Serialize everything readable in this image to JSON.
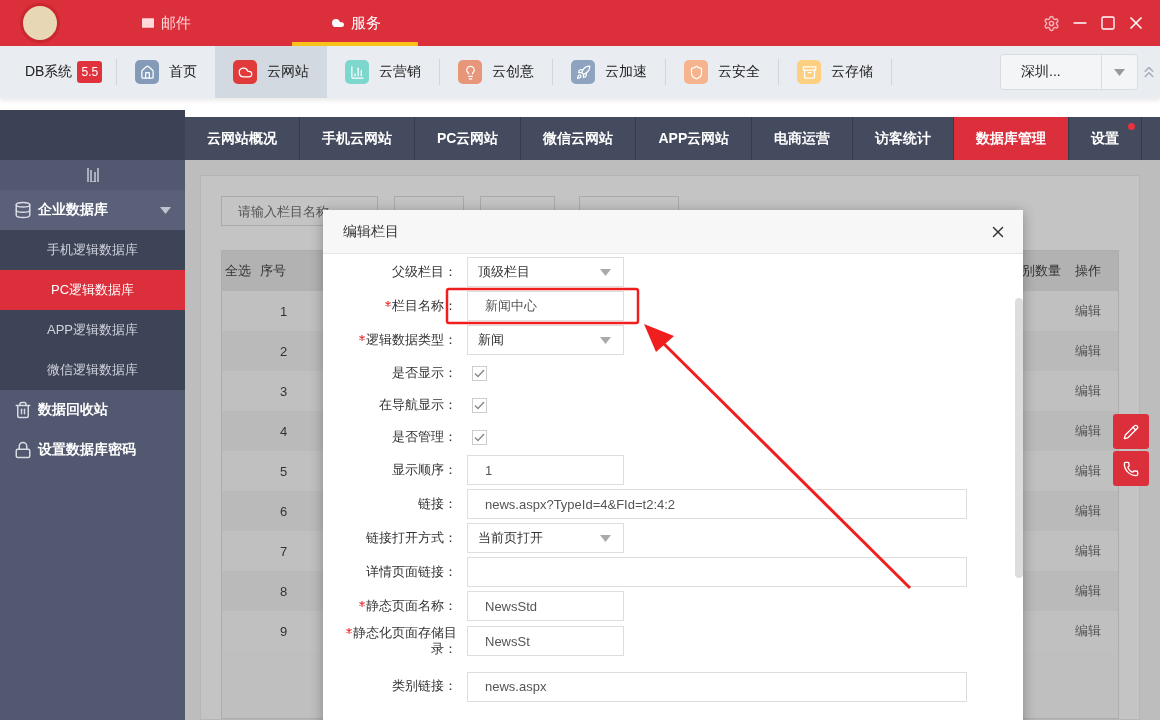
{
  "titlebar": {
    "tabs": [
      {
        "label": "邮件",
        "selected": false
      },
      {
        "label": "服务",
        "selected": true
      }
    ]
  },
  "toolbar": {
    "product": "DB系统",
    "version": "5.5",
    "items": [
      {
        "label": "首页",
        "color": "#849bb8",
        "selected": false
      },
      {
        "label": "云网站",
        "color": "#e03a3a",
        "selected": true
      },
      {
        "label": "云营销",
        "color": "#7dd7cc",
        "selected": false
      },
      {
        "label": "云创意",
        "color": "#e8967a",
        "selected": false
      },
      {
        "label": "云加速",
        "color": "#8da3bf",
        "selected": false
      },
      {
        "label": "云安全",
        "color": "#f5b38e",
        "selected": false
      },
      {
        "label": "云存储",
        "color": "#fdcf80",
        "selected": false
      }
    ],
    "region": "深圳..."
  },
  "sidebar": {
    "items": [
      {
        "label": "企业数据库",
        "expanded": true,
        "children": [
          {
            "label": "手机逻辑数据库",
            "selected": false
          },
          {
            "label": "PC逻辑数据库",
            "selected": true
          },
          {
            "label": "APP逻辑数据库",
            "selected": false
          },
          {
            "label": "微信逻辑数据库",
            "selected": false
          }
        ]
      },
      {
        "label": "数据回收站"
      },
      {
        "label": "设置数据库密码"
      }
    ]
  },
  "nav_tabs": [
    {
      "label": "云网站概况",
      "selected": false,
      "badge": false
    },
    {
      "label": "手机云网站",
      "selected": false,
      "badge": false
    },
    {
      "label": "PC云网站",
      "selected": false,
      "badge": false
    },
    {
      "label": "微信云网站",
      "selected": false,
      "badge": false
    },
    {
      "label": "APP云网站",
      "selected": false,
      "badge": false
    },
    {
      "label": "电商运营",
      "selected": false,
      "badge": false
    },
    {
      "label": "访客统计",
      "selected": false,
      "badge": false
    },
    {
      "label": "数据库管理",
      "selected": true,
      "badge": false
    },
    {
      "label": "设置",
      "selected": false,
      "badge": true
    }
  ],
  "list_page": {
    "search": {
      "placeholder": "请输入栏目名称"
    },
    "table": {
      "columns": [
        "全选",
        "序号",
        "别数量",
        "操作"
      ],
      "rows": [
        {
          "index": "1",
          "action": "编辑"
        },
        {
          "index": "2",
          "action": "编辑"
        },
        {
          "index": "3",
          "action": "编辑"
        },
        {
          "index": "4",
          "action": "编辑"
        },
        {
          "index": "5",
          "action": "编辑"
        },
        {
          "index": "6",
          "action": "编辑"
        },
        {
          "index": "7",
          "action": "编辑"
        },
        {
          "index": "8",
          "action": "编辑"
        },
        {
          "index": "9",
          "action": "编辑"
        }
      ]
    }
  },
  "dialog": {
    "title": "编辑栏目",
    "fields": [
      {
        "kind": "select",
        "label": "父级栏目：",
        "required": false,
        "value": "顶级栏目"
      },
      {
        "kind": "input",
        "label": "栏目名称：",
        "required": true,
        "value": "新闻中心"
      },
      {
        "kind": "select",
        "label": "逻辑数据类型：",
        "required": true,
        "value": "新闻"
      },
      {
        "kind": "checkbox",
        "label": "是否显示：",
        "required": false,
        "checked": true
      },
      {
        "kind": "checkbox",
        "label": "在导航显示：",
        "required": false,
        "checked": true
      },
      {
        "kind": "checkbox",
        "label": "是否管理：",
        "required": false,
        "checked": true
      },
      {
        "kind": "input",
        "label": "显示顺序：",
        "required": false,
        "value": "1"
      },
      {
        "kind": "long_input",
        "label": "链接：",
        "required": false,
        "value": "news.aspx?TypeId=4&FId=t2:4:2"
      },
      {
        "kind": "select",
        "label": "链接打开方式：",
        "required": false,
        "value": "当前页打开"
      },
      {
        "kind": "long_input",
        "label": "详情页面链接：",
        "required": false
      },
      {
        "kind": "input",
        "label": "静态页面名称：",
        "required": true,
        "value": "NewsStd"
      },
      {
        "kind": "input",
        "label": "静态化页面存储目录：",
        "required": true,
        "value": "NewsSt"
      },
      {
        "kind": "long_input",
        "label": "类别链接：",
        "required": false,
        "value": "news.aspx"
      }
    ]
  }
}
